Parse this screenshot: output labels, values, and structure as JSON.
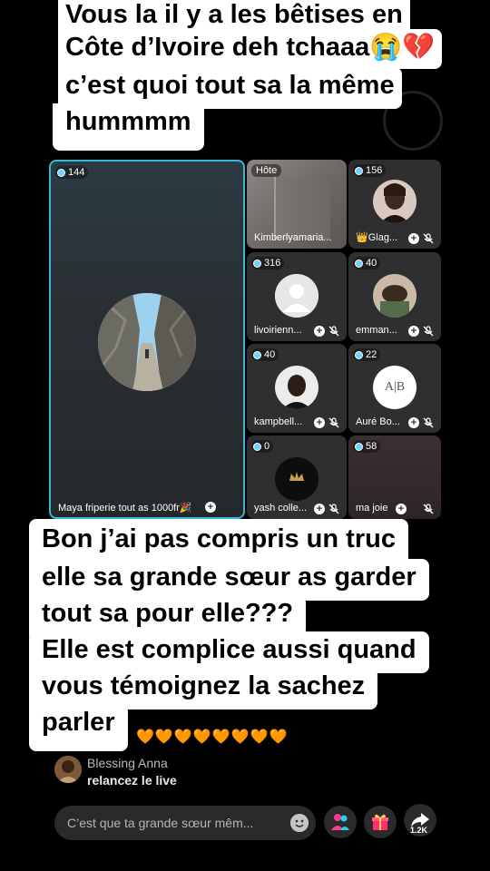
{
  "caption_top": {
    "lines": [
      "Vous la il y a les bêtises en",
      "Côte d’Ivoire deh tchaaa😭💔",
      "c’est quoi tout sa la même",
      "hummmm"
    ]
  },
  "caption_bottom": {
    "lines": [
      "Bon j’ai pas compris un truc",
      "elle sa grande sœur as garder",
      "tout sa pour elle???",
      "Elle est complice aussi quand",
      "vous témoignez la sachez",
      "parler"
    ]
  },
  "grid": {
    "main": {
      "count": "144",
      "name": "Maya friperie tout as 1000fr🎉"
    },
    "host": {
      "label": "Hôte",
      "name": "Kimberlyamaria..."
    },
    "tiles": [
      {
        "count": "156",
        "name": "👑Glag..."
      },
      {
        "count": "316",
        "name": "livoirienn..."
      },
      {
        "count": "40",
        "name": "emman..."
      },
      {
        "count": "40",
        "name": "kampbell..."
      },
      {
        "count": "22",
        "name": "Auré Bo..."
      },
      {
        "count": "0",
        "name": "yash colle..."
      },
      {
        "count": "58",
        "name": "ma joie"
      }
    ],
    "logo_text": "A|B"
  },
  "comments": {
    "hearts": "🧡🧡🧡🧡🧡🧡🧡🧡",
    "items": [
      {
        "author": "Blessing Anna",
        "text": "relancez le live"
      }
    ]
  },
  "input": {
    "placeholder": "C’est que ta grande sœur mêm..."
  },
  "actions": {
    "share_count": "1.2K"
  },
  "icons": {
    "emoji": "smiley-icon",
    "invite": "people-icon",
    "gift": "gift-icon",
    "share": "share-arrow-icon",
    "mute": "mic-muted-icon"
  }
}
